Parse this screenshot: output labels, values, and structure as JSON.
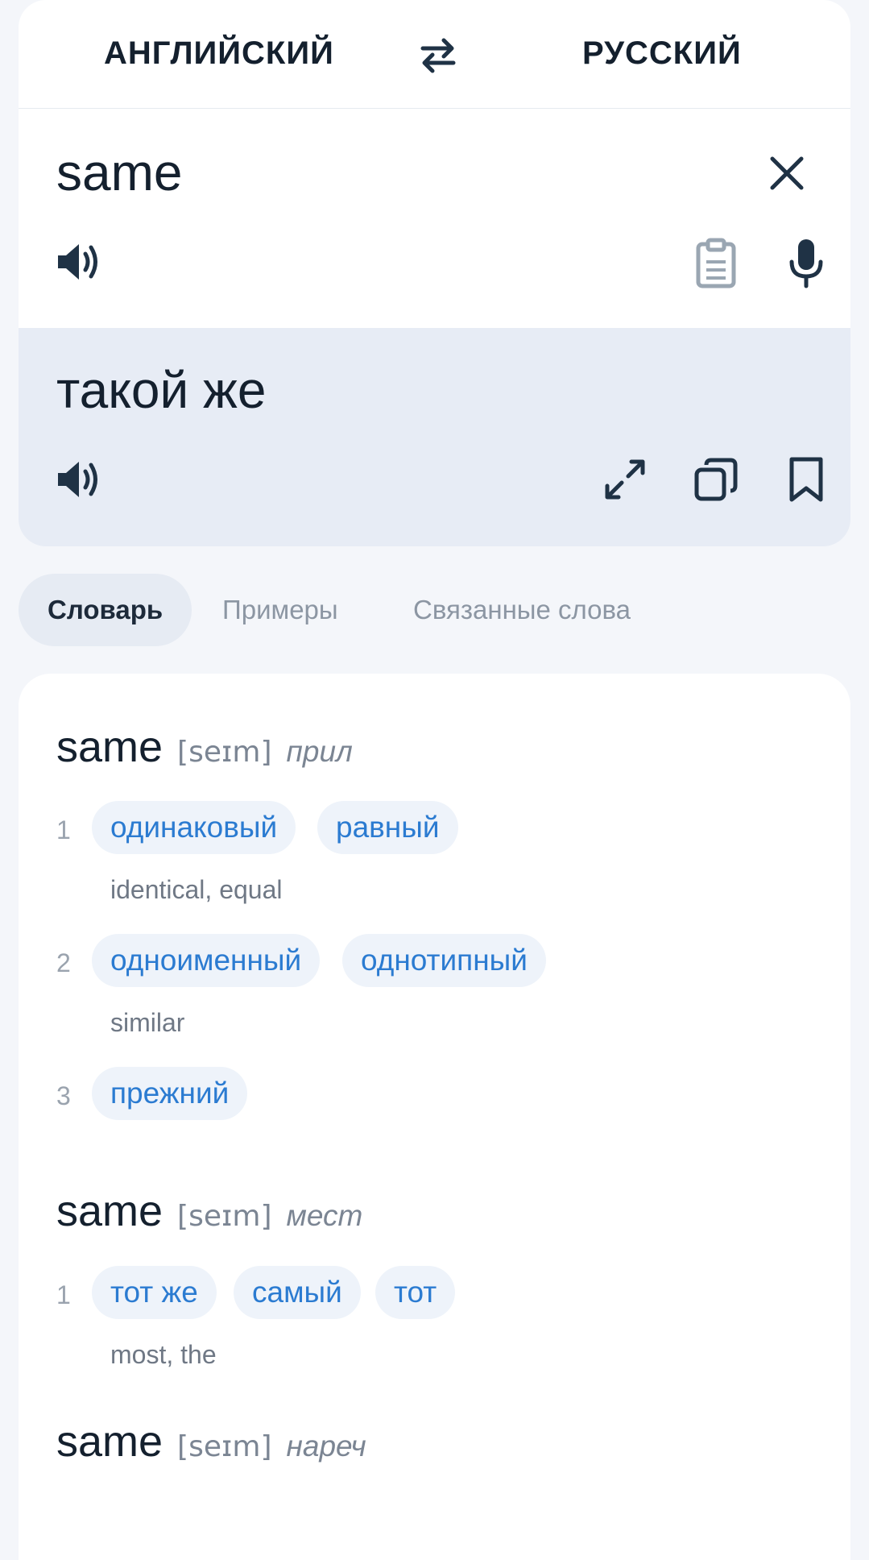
{
  "languages": {
    "source": "АНГЛИЙСКИЙ",
    "target": "РУССКИЙ"
  },
  "source": {
    "text": "same"
  },
  "result": {
    "text": "такой же"
  },
  "tabs": [
    "Словарь",
    "Примеры",
    "Связанные слова"
  ],
  "entries": [
    {
      "headword": "same",
      "transcription": "[seɪm]",
      "pos": "прил",
      "senses": [
        {
          "num": "1",
          "translations": [
            "одинаковый",
            "равный"
          ],
          "gloss": "identical, equal"
        },
        {
          "num": "2",
          "translations": [
            "одноименный",
            "однотипный"
          ],
          "gloss": "similar"
        },
        {
          "num": "3",
          "translations": [
            "прежний"
          ],
          "gloss": ""
        }
      ]
    },
    {
      "headword": "same",
      "transcription": "[seɪm]",
      "pos": "мест",
      "senses": [
        {
          "num": "1",
          "translations": [
            "тот же",
            "самый",
            "тот"
          ],
          "gloss": "most, the"
        }
      ]
    },
    {
      "headword": "same",
      "transcription": "[seɪm]",
      "pos": "нареч",
      "senses": []
    }
  ],
  "colors": {
    "accent": "#2b7bd1",
    "chip_bg": "#eef3fa",
    "result_bg": "#e7ecf5",
    "icon": "#1f3245"
  },
  "icons": [
    "swap-icon",
    "close-icon",
    "speaker-icon",
    "clipboard-icon",
    "microphone-icon",
    "expand-icon",
    "copy-icon",
    "bookmark-icon"
  ]
}
